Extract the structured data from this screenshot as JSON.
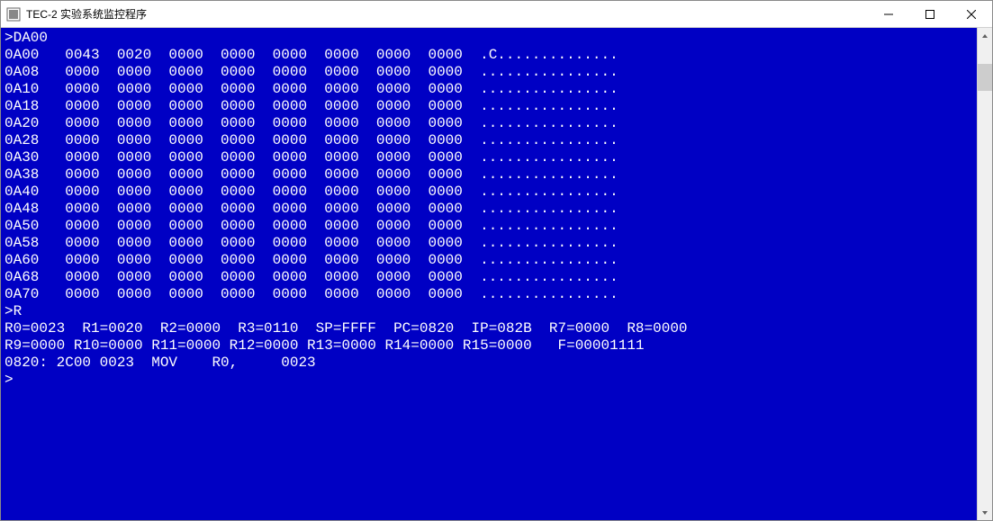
{
  "window": {
    "title": "TEC-2 实验系统监控程序"
  },
  "console": {
    "prompt_line": ">DA00",
    "dump_rows": [
      {
        "addr": "0A00",
        "words": [
          "0043",
          "0020",
          "0000",
          "0000",
          "0000",
          "0000",
          "0000",
          "0000"
        ],
        "ascii": ".C.............."
      },
      {
        "addr": "0A08",
        "words": [
          "0000",
          "0000",
          "0000",
          "0000",
          "0000",
          "0000",
          "0000",
          "0000"
        ],
        "ascii": "................"
      },
      {
        "addr": "0A10",
        "words": [
          "0000",
          "0000",
          "0000",
          "0000",
          "0000",
          "0000",
          "0000",
          "0000"
        ],
        "ascii": "................"
      },
      {
        "addr": "0A18",
        "words": [
          "0000",
          "0000",
          "0000",
          "0000",
          "0000",
          "0000",
          "0000",
          "0000"
        ],
        "ascii": "................"
      },
      {
        "addr": "0A20",
        "words": [
          "0000",
          "0000",
          "0000",
          "0000",
          "0000",
          "0000",
          "0000",
          "0000"
        ],
        "ascii": "................"
      },
      {
        "addr": "0A28",
        "words": [
          "0000",
          "0000",
          "0000",
          "0000",
          "0000",
          "0000",
          "0000",
          "0000"
        ],
        "ascii": "................"
      },
      {
        "addr": "0A30",
        "words": [
          "0000",
          "0000",
          "0000",
          "0000",
          "0000",
          "0000",
          "0000",
          "0000"
        ],
        "ascii": "................"
      },
      {
        "addr": "0A38",
        "words": [
          "0000",
          "0000",
          "0000",
          "0000",
          "0000",
          "0000",
          "0000",
          "0000"
        ],
        "ascii": "................"
      },
      {
        "addr": "0A40",
        "words": [
          "0000",
          "0000",
          "0000",
          "0000",
          "0000",
          "0000",
          "0000",
          "0000"
        ],
        "ascii": "................"
      },
      {
        "addr": "0A48",
        "words": [
          "0000",
          "0000",
          "0000",
          "0000",
          "0000",
          "0000",
          "0000",
          "0000"
        ],
        "ascii": "................"
      },
      {
        "addr": "0A50",
        "words": [
          "0000",
          "0000",
          "0000",
          "0000",
          "0000",
          "0000",
          "0000",
          "0000"
        ],
        "ascii": "................"
      },
      {
        "addr": "0A58",
        "words": [
          "0000",
          "0000",
          "0000",
          "0000",
          "0000",
          "0000",
          "0000",
          "0000"
        ],
        "ascii": "................"
      },
      {
        "addr": "0A60",
        "words": [
          "0000",
          "0000",
          "0000",
          "0000",
          "0000",
          "0000",
          "0000",
          "0000"
        ],
        "ascii": "................"
      },
      {
        "addr": "0A68",
        "words": [
          "0000",
          "0000",
          "0000",
          "0000",
          "0000",
          "0000",
          "0000",
          "0000"
        ],
        "ascii": "................"
      },
      {
        "addr": "0A70",
        "words": [
          "0000",
          "0000",
          "0000",
          "0000",
          "0000",
          "0000",
          "0000",
          "0000"
        ],
        "ascii": "................"
      }
    ],
    "r_command": ">R",
    "registers_line1": "R0=0023  R1=0020  R2=0000  R3=0110  SP=FFFF  PC=0820  IP=082B  R7=0000  R8=0000",
    "registers_line2": "R9=0000 R10=0000 R11=0000 R12=0000 R13=0000 R14=0000 R15=0000   F=00001111",
    "disasm_line": "0820: 2C00 0023  MOV    R0,     0023",
    "final_prompt": ">"
  }
}
